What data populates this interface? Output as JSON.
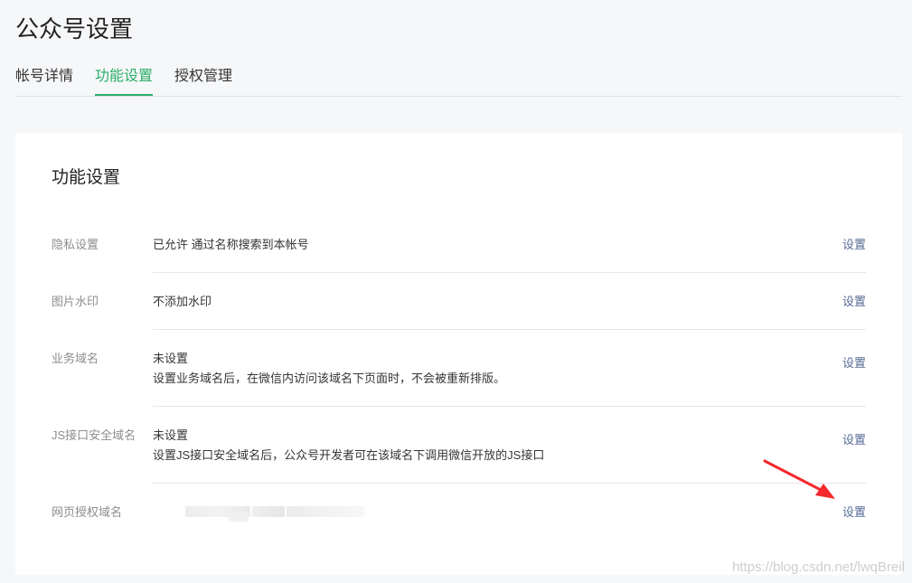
{
  "page": {
    "title": "公众号设置"
  },
  "tabs": [
    {
      "label": "帐号详情",
      "active": false
    },
    {
      "label": "功能设置",
      "active": true
    },
    {
      "label": "授权管理",
      "active": false
    }
  ],
  "card": {
    "title": "功能设置",
    "rows": [
      {
        "label": "隐私设置",
        "value_lines": [
          "已允许 通过名称搜索到本帐号"
        ],
        "action": "设置"
      },
      {
        "label": "图片水印",
        "value_lines": [
          "不添加水印"
        ],
        "action": "设置"
      },
      {
        "label": "业务域名",
        "value_lines": [
          "未设置",
          "设置业务域名后，在微信内访问该域名下页面时，不会被重新排版。"
        ],
        "action": "设置"
      },
      {
        "label": "JS接口安全域名",
        "value_lines": [
          "未设置",
          "设置JS接口安全域名后，公众号开发者可在该域名下调用微信开放的JS接口"
        ],
        "action": "设置"
      },
      {
        "label": "网页授权域名",
        "value_lines": [],
        "value_obscured": true,
        "action": "设置"
      }
    ]
  },
  "annotation": {
    "arrow_color": "#f5282d",
    "arrow_target": "网页授权域名 设置"
  },
  "watermark": {
    "text": "https://blog.csdn.net/lwqBreil"
  },
  "colors": {
    "accent": "#2aae67",
    "link": "#576b95",
    "label_gray": "#8d8d8d",
    "background": "#f6f7f9"
  }
}
